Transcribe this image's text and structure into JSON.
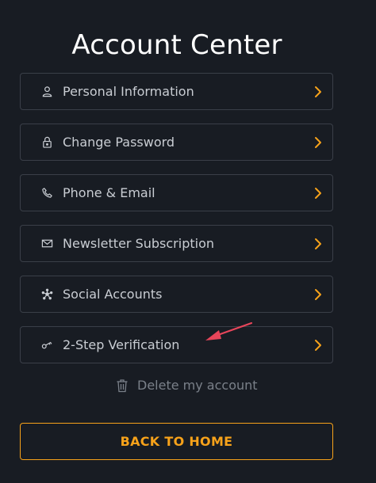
{
  "page": {
    "title": "Account Center"
  },
  "menu": {
    "items": [
      {
        "label": "Personal Information",
        "icon": "user-icon"
      },
      {
        "label": "Change Password",
        "icon": "lock-icon"
      },
      {
        "label": "Phone & Email",
        "icon": "phone-icon"
      },
      {
        "label": "Newsletter Subscription",
        "icon": "mail-icon"
      },
      {
        "label": "Social Accounts",
        "icon": "social-network-icon"
      },
      {
        "label": "2-Step Verification",
        "icon": "key-icon"
      }
    ],
    "chevron_icon": "chevron-right-icon"
  },
  "delete_account": {
    "label": "Delete my account",
    "icon": "trash-icon"
  },
  "back_button": {
    "label": "BACK TO HOME"
  },
  "colors": {
    "background": "#181c23",
    "accent": "#f7a21a",
    "annotation_arrow": "#e8455a"
  }
}
